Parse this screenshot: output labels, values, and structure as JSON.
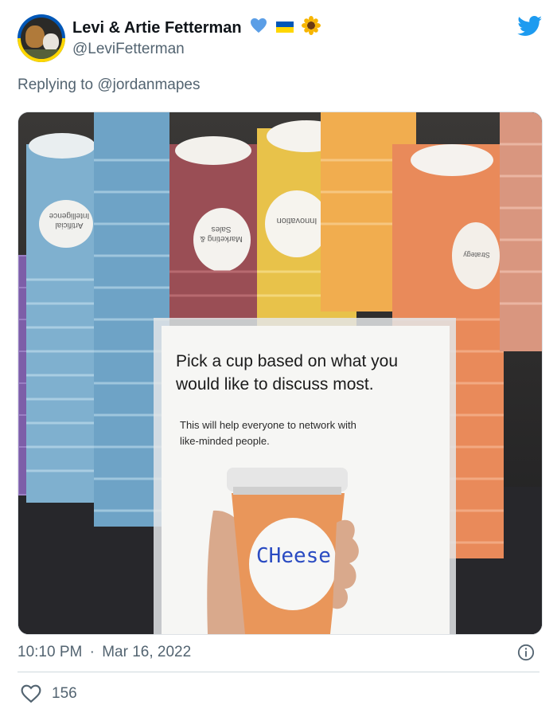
{
  "tweet": {
    "author": {
      "display_name": "Levi & Artie Fetterman",
      "handle": "@LeviFetterman",
      "name_emojis": [
        "blue-heart-icon",
        "ukraine-flag-icon",
        "sunflower-icon"
      ]
    },
    "replying_prefix": "Replying to",
    "replying_to": "@jordanmapes",
    "image": {
      "cup_labels": [
        "Artificial Intelligence",
        "Marketing & Sales",
        "Innovation",
        "Strategy"
      ],
      "sign": {
        "headline_line1": "Pick a cup based on what you",
        "headline_line2": "would like to discuss most.",
        "subtext_line1": "This will help everyone to network with",
        "subtext_line2": "like-minded people.",
        "cup_word": "CHeese"
      }
    },
    "time": "10:10 PM",
    "separator": "·",
    "date": "Mar 16, 2022",
    "likes": "156"
  },
  "colors": {
    "twitter_blue": "#1d9bf0",
    "secondary_text": "#536471",
    "ukraine_blue": "#0057b7",
    "ukraine_yellow": "#ffd700"
  }
}
